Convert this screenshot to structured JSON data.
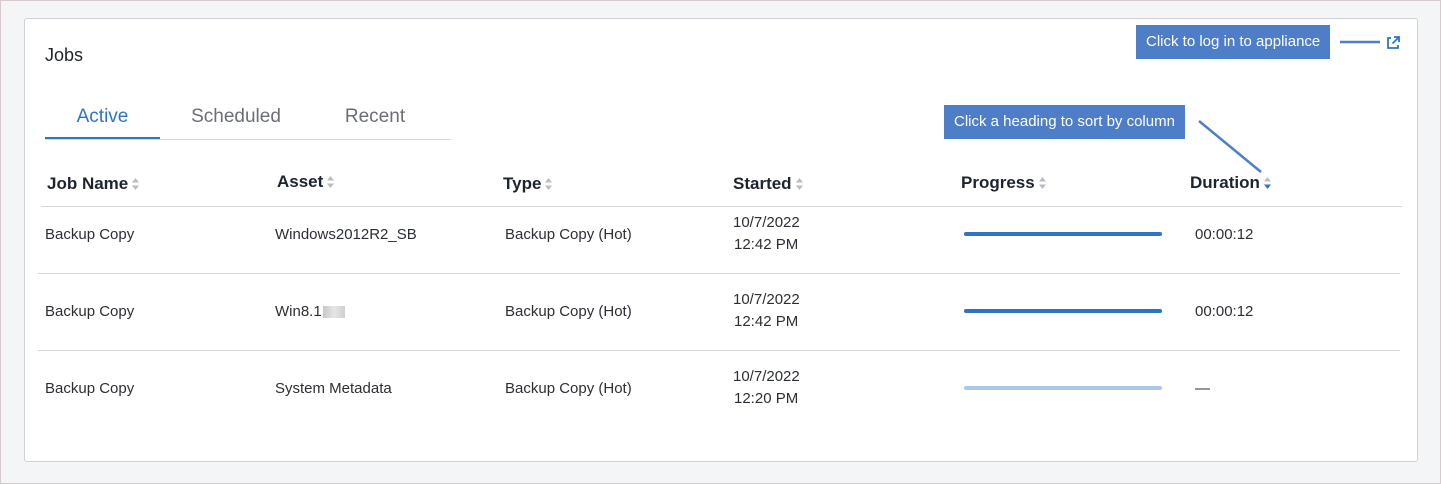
{
  "card": {
    "title": "Jobs"
  },
  "tabs": [
    {
      "label": "Active",
      "selected": true
    },
    {
      "label": "Scheduled",
      "selected": false
    },
    {
      "label": "Recent",
      "selected": false
    }
  ],
  "columns": [
    {
      "label": "Job Name",
      "sort": "none"
    },
    {
      "label": "Asset",
      "sort": "none"
    },
    {
      "label": "Type",
      "sort": "none"
    },
    {
      "label": "Started",
      "sort": "none"
    },
    {
      "label": "Progress",
      "sort": "none"
    },
    {
      "label": "Duration",
      "sort": "descending"
    }
  ],
  "rows": [
    {
      "job_name": "Backup Copy",
      "asset": "Windows2012R2_SB",
      "type": "Backup Copy (Hot)",
      "started_date": "10/7/2022",
      "started_time": "12:42 PM",
      "progress": 1.0,
      "duration": "00:00:12"
    },
    {
      "job_name": "Backup Copy",
      "asset": "Win8.1",
      "type": "Backup Copy (Hot)",
      "started_date": "10/7/2022",
      "started_time": "12:42 PM",
      "progress": 1.0,
      "duration": "00:00:12"
    },
    {
      "job_name": "Backup Copy",
      "asset": "System Metadata",
      "type": "Backup Copy (Hot)",
      "started_date": "10/7/2022",
      "started_time": "12:20 PM",
      "progress": 0.0,
      "duration": "—"
    }
  ],
  "callouts": {
    "login": "Click to log in to appliance",
    "sort": "Click a heading to sort by column"
  },
  "colors": {
    "accent": "#2f74c0",
    "progress_fill": "#2f74c0",
    "progress_track": "#a9c8ea",
    "callout_bg": "#4f7ec9"
  },
  "icons": {
    "external_link": "external-link-icon",
    "sort": "sort-icon"
  }
}
